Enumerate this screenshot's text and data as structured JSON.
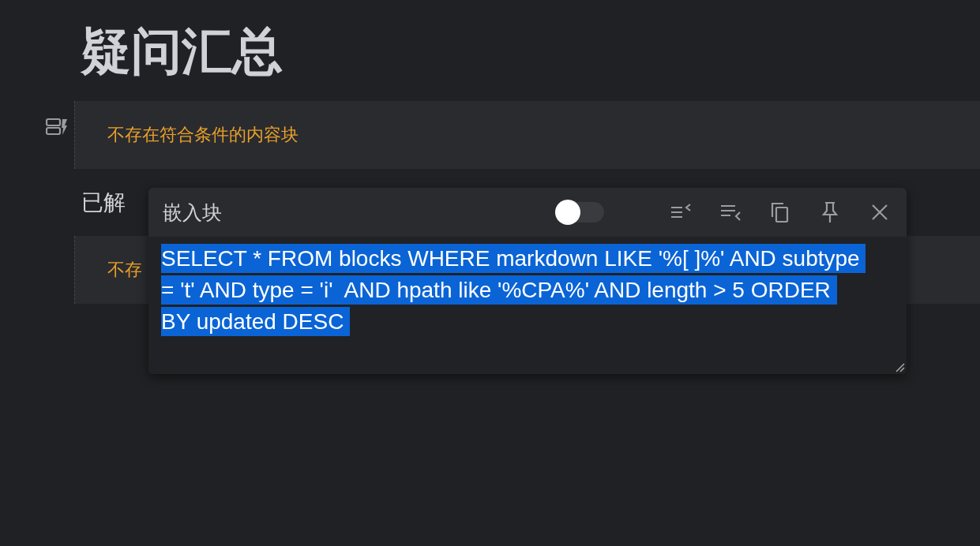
{
  "title": "疑问汇总",
  "blocks": [
    {
      "kind": "embed",
      "message": "不存在符合条件的内容块",
      "show_icon": true
    },
    {
      "kind": "heading",
      "text": "已解"
    },
    {
      "kind": "embed",
      "message": "不存",
      "show_icon": false
    }
  ],
  "popup": {
    "title": "嵌入块",
    "toggle": {
      "on": false
    },
    "query": {
      "selected": true,
      "lines": [
        "SELECT * FROM blocks WHERE markdown LIKE '%[ ]%' AND subtype ",
        "= 't' AND type = 'i'  AND hpath like '%CPA%' AND length > 5 ORDER ",
        "BY updated DESC "
      ]
    }
  }
}
